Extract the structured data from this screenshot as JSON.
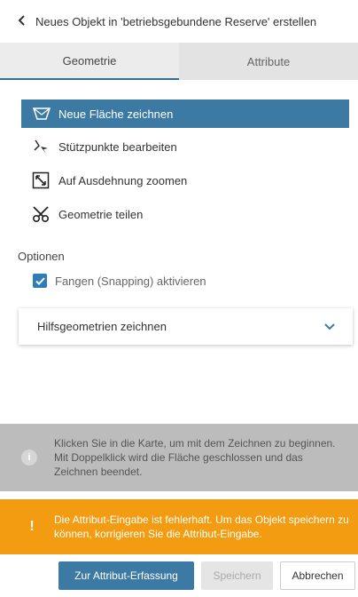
{
  "header": {
    "title": "Neues Objekt in 'betriebsgebundene Reserve' erstellen",
    "back_icon": "chevron-left-icon"
  },
  "tabs": [
    {
      "label": "Geometrie",
      "active": true
    },
    {
      "label": "Attribute",
      "active": false
    }
  ],
  "tools": [
    {
      "label": "Neue Fläche zeichnen",
      "icon": "polygon-draw-icon",
      "active": true
    },
    {
      "label": "Stützpunkte bearbeiten",
      "icon": "edit-vertices-icon",
      "active": false
    },
    {
      "label": "Auf Ausdehnung zoomen",
      "icon": "zoom-extent-icon",
      "active": false
    },
    {
      "label": "Geometrie teilen",
      "icon": "scissors-icon",
      "active": false
    }
  ],
  "options": {
    "heading": "Optionen",
    "snapping_label": "Fangen (Snapping) aktivieren",
    "snapping_checked": true
  },
  "accordion": {
    "label": "Hilfsgeometrien zeichnen",
    "icon": "chevron-down-icon"
  },
  "info_message": "Klicken Sie in die Karte, um mit dem Zeichnen zu beginnen. Mit Doppelklick wird die Fläche geschlossen und das Zeichnen beendet.",
  "warning_message": "Die Attribut-Eingabe ist fehlerhaft. Um das Objekt speichern zu können, korrigieren Sie die Attribut-Eingabe.",
  "warning_icon_glyph": "!",
  "info_icon_glyph": "i",
  "buttons": {
    "attribute_capture": "Zur Attribut-Erfassung",
    "save": "Speichern",
    "cancel": "Abbrechen"
  },
  "colors": {
    "accent": "#3d7aa3",
    "warning": "#f39c12",
    "info_bg": "#bcbcbc",
    "checkbox": "#2e7db8"
  }
}
